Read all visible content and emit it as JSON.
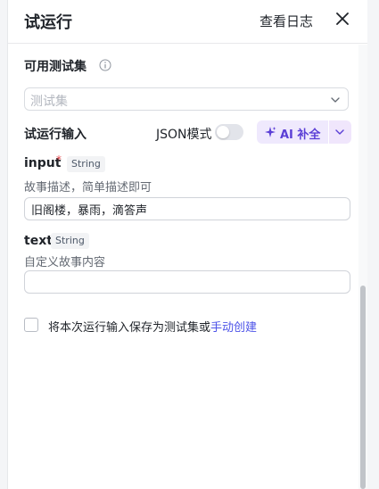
{
  "header": {
    "title": "试运行",
    "log_label": "查看日志"
  },
  "testset": {
    "label": "可用测试集",
    "placeholder": "测试集"
  },
  "run_input": {
    "label": "试运行输入",
    "json_mode_label": "JSON模式",
    "json_mode_on": false,
    "ai_button_label": "AI 补全"
  },
  "fields": [
    {
      "name": "input",
      "required_mark": "*",
      "type": "String",
      "description": "故事描述，简单描述即可",
      "value": "旧阁楼，暴雨，滴答声"
    },
    {
      "name": "text",
      "type": "String",
      "description": "自定义故事内容",
      "value": ""
    }
  ],
  "save": {
    "text": "将本次运行输入保存为测试集或",
    "link": "手动创建",
    "checked": false
  },
  "colors": {
    "accent": "#4d53e8",
    "ai_purple": "#5b3fd6",
    "required": "#e5484d"
  }
}
